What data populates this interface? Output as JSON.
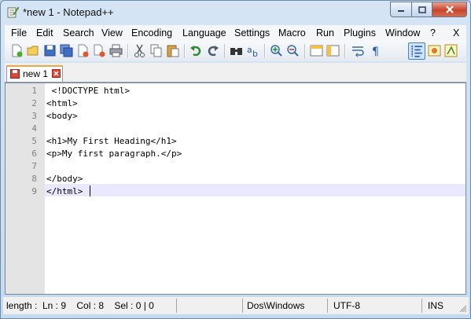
{
  "window": {
    "title": "*new 1 - Notepad++"
  },
  "menu": [
    "File",
    "Edit",
    "Search",
    "View",
    "Encoding",
    "Language",
    "Settings",
    "Macro",
    "Run",
    "Plugins",
    "Window",
    "?",
    "X"
  ],
  "toolbar_icons": [
    "new-file-icon",
    "open-file-icon",
    "save-icon",
    "save-all-icon",
    "close-icon",
    "close-all-icon",
    "print-icon",
    "cut-icon",
    "copy-icon",
    "paste-icon",
    "undo-icon",
    "redo-icon",
    "find-icon",
    "replace-icon",
    "zoom-in-icon",
    "zoom-out-icon",
    "sync-vertical-icon",
    "sync-horizontal-icon",
    "word-wrap-icon",
    "show-all-chars-icon",
    "indent-guide-icon",
    "user-language-icon",
    "function-list-icon"
  ],
  "tab": {
    "label": "new 1"
  },
  "editor": {
    "line_numbers": [
      "1",
      "2",
      "3",
      "4",
      "5",
      "6",
      "7",
      "8",
      "9"
    ],
    "lines": [
      " <!DOCTYPE html>",
      "<html>",
      "<body>",
      "",
      "<h1>My First Heading</h1>",
      "<p>My first paragraph.</p>",
      "",
      "</body>",
      "</html>"
    ],
    "current_line": 9
  },
  "status": {
    "length": "length :",
    "position": "Ln : 9    Col : 8    Sel : 0 | 0",
    "eol": "Dos\\Windows",
    "encoding": "UTF-8",
    "mode": "INS"
  },
  "colors": {
    "current_line": "#e8e8ff",
    "gutter": "#e4e4e4",
    "tab_accent": "#f2a64a"
  }
}
